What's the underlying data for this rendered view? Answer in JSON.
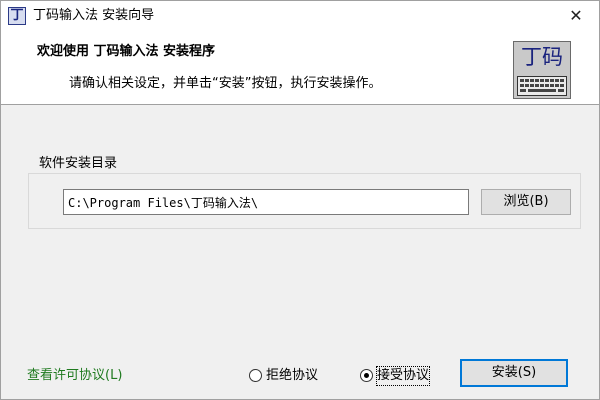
{
  "window": {
    "title": "丁码输入法 安装向导",
    "app_icon_glyph": "丁",
    "close_glyph": "✕"
  },
  "header": {
    "title": "欢迎使用 丁码输入法 安装程序",
    "subtitle": "请确认相关设定，并单击“安装”按钮，执行安装操作。",
    "logo_text": "丁码",
    "logo_icon": "keyboard-icon"
  },
  "install_dir": {
    "group_label": "软件安装目录",
    "path_value": "C:\\Program Files\\丁码输入法\\",
    "browse_label": "浏览(B)"
  },
  "footer": {
    "license_link": "查看许可协议(L)",
    "decline_label": "拒绝协议",
    "accept_label": "接受协议",
    "selected_option": "accept",
    "install_label": "安装(S)"
  },
  "colors": {
    "link_green": "#1f7a1f",
    "focus_blue": "#0078d7",
    "logo_blue": "#1a237e"
  }
}
